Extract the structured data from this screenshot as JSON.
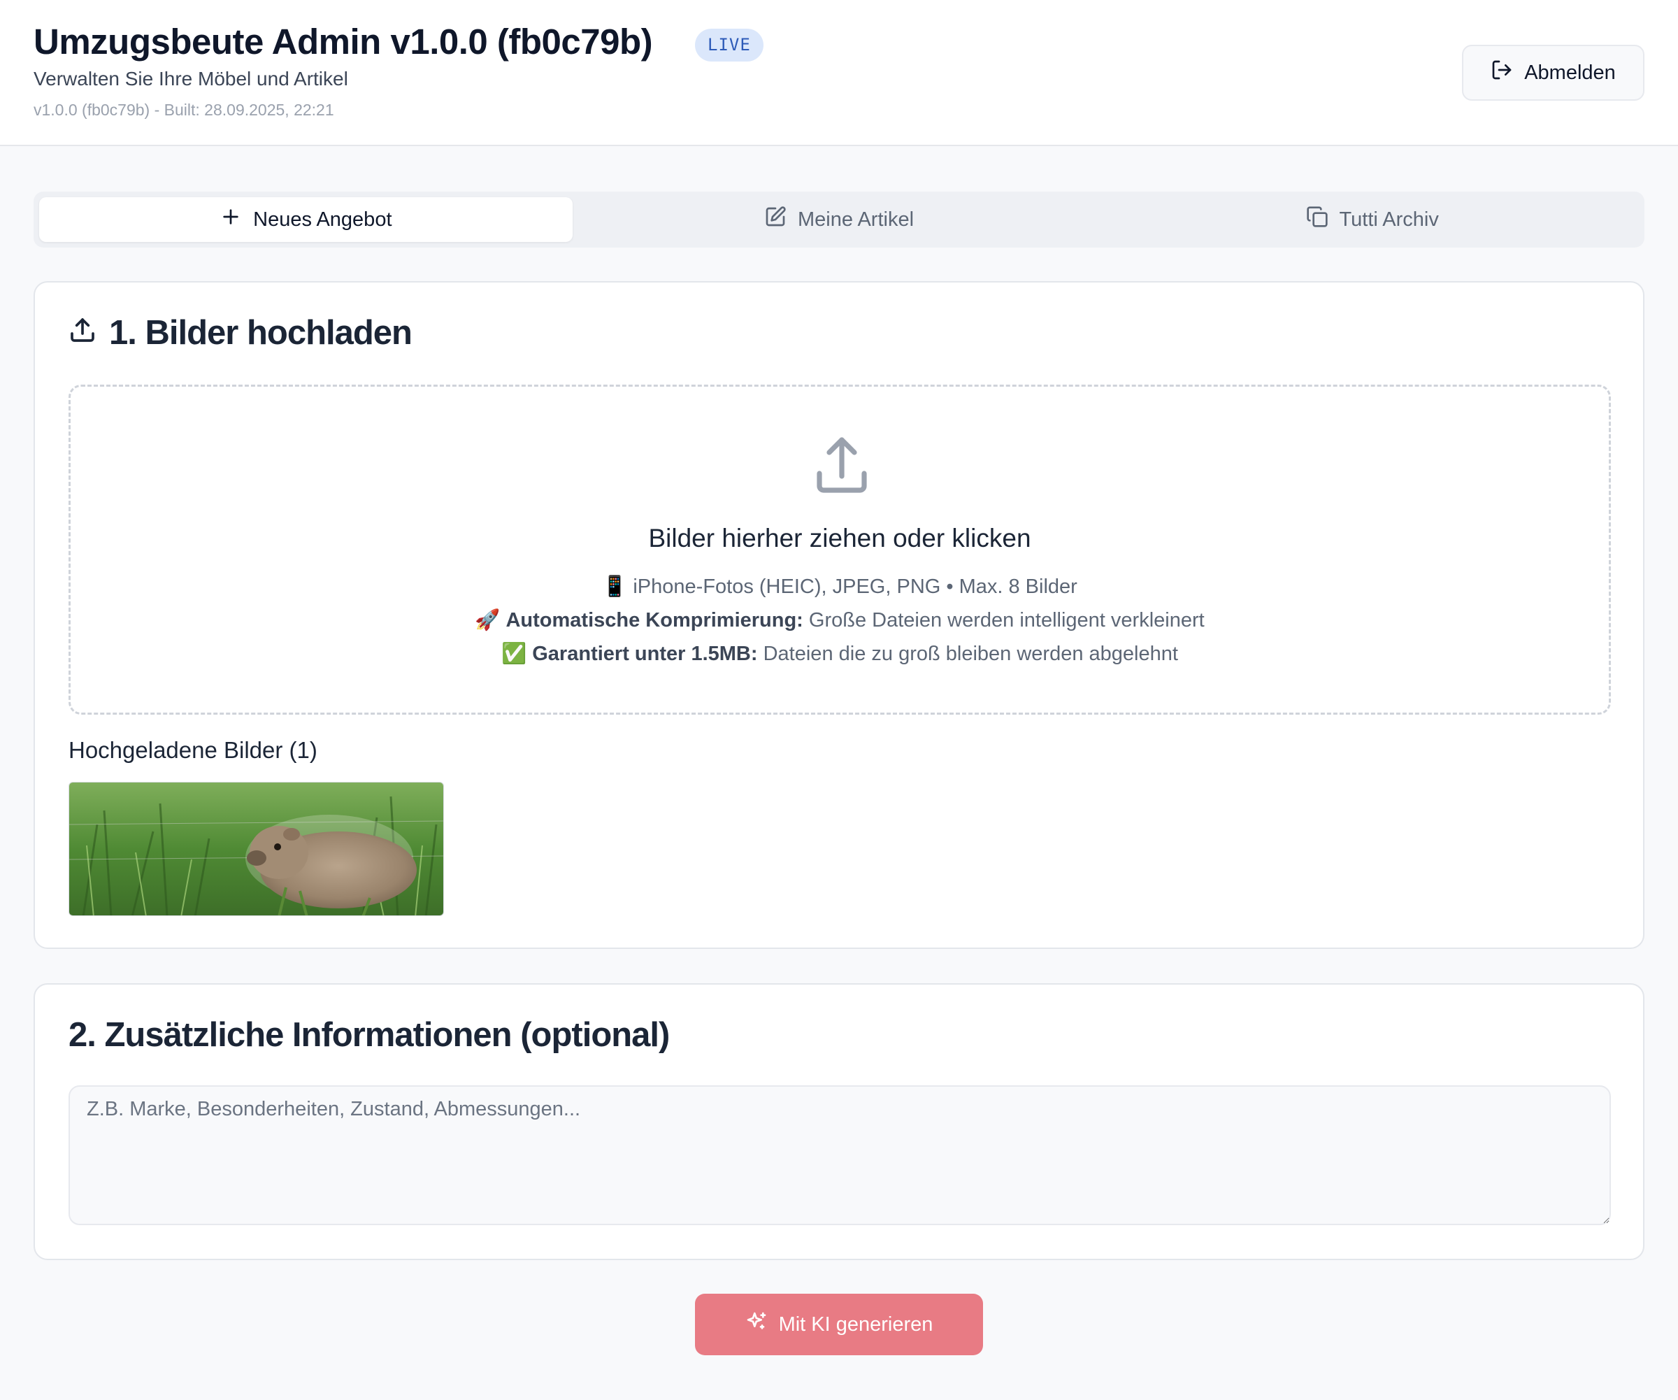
{
  "header": {
    "title": "Umzugsbeute Admin v1.0.0 (fb0c79b)",
    "badge": "LIVE",
    "subtitle": "Verwalten Sie Ihre Möbel und Artikel",
    "build_info": "v1.0.0 (fb0c79b) - Built: 28.09.2025, 22:21",
    "logout_label": "Abmelden"
  },
  "tabs": [
    {
      "label": "Neues Angebot",
      "icon": "plus-icon",
      "active": true
    },
    {
      "label": "Meine Artikel",
      "icon": "edit-icon",
      "active": false
    },
    {
      "label": "Tutti Archiv",
      "icon": "copy-icon",
      "active": false
    }
  ],
  "upload": {
    "title": "1. Bilder hochladen",
    "dropzone_title": "Bilder hierher ziehen oder klicken",
    "formats_emoji": "📱",
    "formats": "iPhone-Fotos (HEIC), JPEG, PNG • Max. 8 Bilder",
    "compression_emoji": "🚀",
    "compression_bold": "Automatische Komprimierung:",
    "compression_text": "Große Dateien werden intelligent verkleinert",
    "limit_emoji": "✅",
    "limit_bold": "Garantiert unter 1.5MB:",
    "limit_text": "Dateien die zu groß bleiben werden abgelehnt",
    "uploaded_label": "Hochgeladene Bilder (1)"
  },
  "info": {
    "title": "2. Zusätzliche Informationen (optional)",
    "placeholder": "Z.B. Marke, Besonderheiten, Zustand, Abmessungen...",
    "value": ""
  },
  "generate_label": "Mit KI generieren",
  "colors": {
    "accent": "#e87b84",
    "badge_bg": "#dbe7fb",
    "badge_text": "#2d5bb8",
    "background": "#f8f9fb"
  }
}
